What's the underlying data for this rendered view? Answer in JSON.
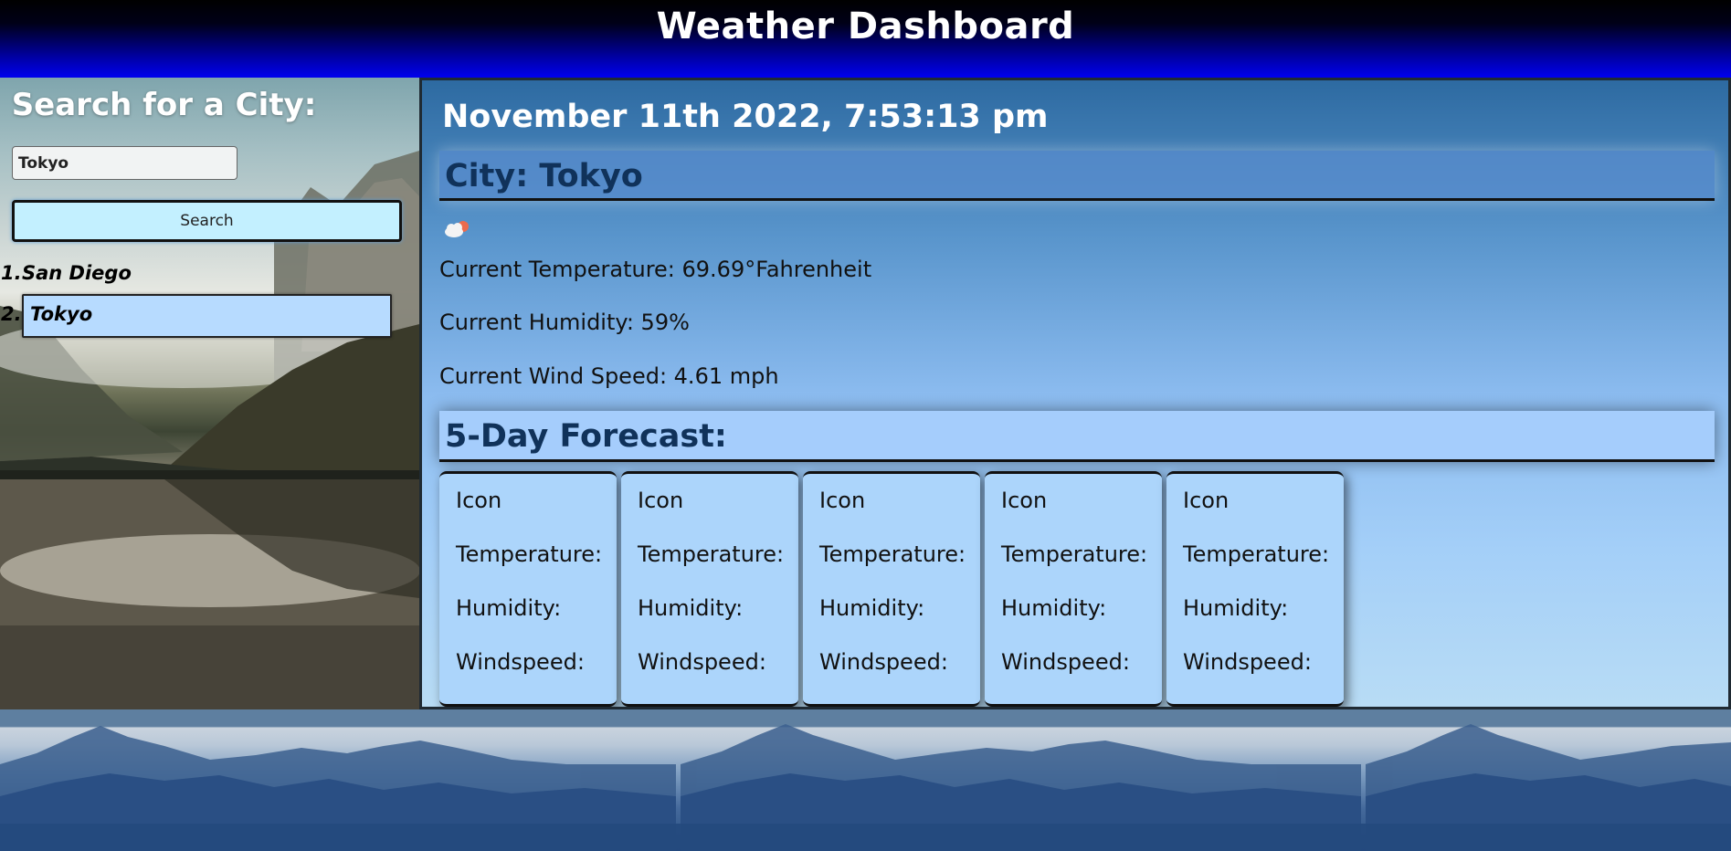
{
  "header": {
    "title": "Weather Dashboard"
  },
  "sidebar": {
    "title": "Search for a City:",
    "search_input": {
      "value": "Tokyo",
      "placeholder": ""
    },
    "search_button": "Search",
    "history": [
      {
        "num": "1.",
        "city": "San Diego",
        "active": false
      },
      {
        "num": "2.",
        "city": "Tokyo",
        "active": true
      }
    ]
  },
  "main": {
    "datetime": "November 11th 2022, 7:53:13 pm",
    "city_heading": "City: Tokyo",
    "weather_icon": "partly-cloudy-night-icon",
    "temperature": "Current Temperature: 69.69°Fahrenheit",
    "humidity": "Current Humidity: 59%",
    "wind": "Current Wind Speed: 4.61 mph",
    "forecast_heading": "5-Day Forecast:",
    "forecast": [
      {
        "icon": "Icon",
        "temp": "Temperature:",
        "humidity": "Humidity:",
        "wind": "Windspeed:"
      },
      {
        "icon": "Icon",
        "temp": "Temperature:",
        "humidity": "Humidity:",
        "wind": "Windspeed:"
      },
      {
        "icon": "Icon",
        "temp": "Temperature:",
        "humidity": "Humidity:",
        "wind": "Windspeed:"
      },
      {
        "icon": "Icon",
        "temp": "Temperature:",
        "humidity": "Humidity:",
        "wind": "Windspeed:"
      },
      {
        "icon": "Icon",
        "temp": "Temperature:",
        "humidity": "Humidity:",
        "wind": "Windspeed:"
      }
    ]
  },
  "colors": {
    "header_gradient_end": "#0000ee",
    "search_button_bg": "#c3f0ff",
    "active_history_bg": "#b7dbff",
    "forecast_card_bg": "#acd5fb",
    "heading_text": "#10325a"
  }
}
